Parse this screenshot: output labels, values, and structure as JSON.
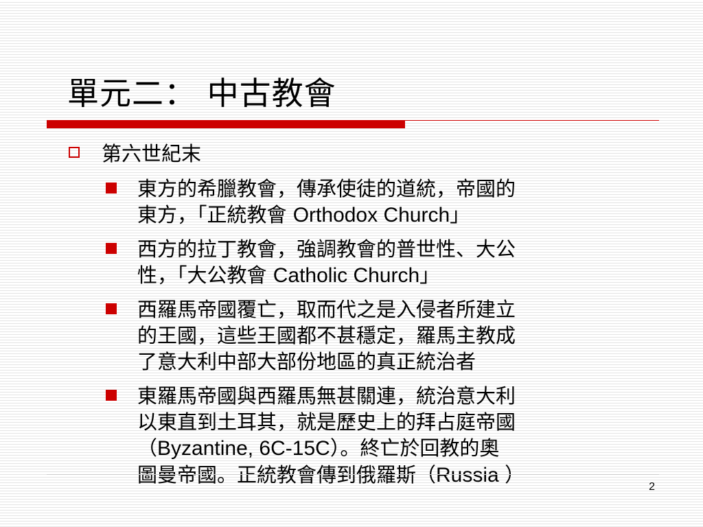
{
  "slide": {
    "title": "單元二： 中古教會",
    "page_number": "2",
    "colors": {
      "accent": "#cc0000",
      "background": "#ffffff",
      "stripe": "#e4e4e4",
      "text": "#000000"
    },
    "outline": {
      "heading": "第六世紀末",
      "bullet_icon": "hollow-square-icon",
      "items": [
        {
          "bullet_icon": "filled-square-icon",
          "lines": [
            [
              {
                "text": "東方的希臘教會，傳承使徒的道統，帝國的"
              }
            ],
            [
              {
                "text": "東方，「正統教會 "
              },
              {
                "text": "Orthodox Church",
                "latin": true
              },
              {
                "text": "」"
              }
            ]
          ]
        },
        {
          "bullet_icon": "filled-square-icon",
          "lines": [
            [
              {
                "text": "西方的拉丁教會，強調教會的普世性、大公"
              }
            ],
            [
              {
                "text": "性，「大公教會 "
              },
              {
                "text": "Catholic Church",
                "latin": true
              },
              {
                "text": "」"
              }
            ]
          ]
        },
        {
          "bullet_icon": "filled-square-icon",
          "lines": [
            [
              {
                "text": "西羅馬帝國覆亡，取而代之是入侵者所建立"
              }
            ],
            [
              {
                "text": "的王國，這些王國都不甚穩定，羅馬主教成"
              }
            ],
            [
              {
                "text": "了意大利中部大部份地區的真正統治者"
              }
            ]
          ]
        },
        {
          "bullet_icon": "filled-square-icon",
          "lines": [
            [
              {
                "text": "東羅馬帝國與西羅馬無甚關連，統治意大利"
              }
            ],
            [
              {
                "text": "以東直到土耳其，就是歷史上的拜占庭帝國"
              }
            ],
            [
              {
                "text": "（"
              },
              {
                "text": "Byzantine, 6C-15C",
                "latin": true
              },
              {
                "text": "）。終亡於回教的奧"
              }
            ],
            [
              {
                "text": "圖曼帝國。正統教會傳到俄羅斯（"
              },
              {
                "text": "Russia ",
                "latin": true
              },
              {
                "text": "）"
              }
            ]
          ]
        }
      ]
    }
  }
}
